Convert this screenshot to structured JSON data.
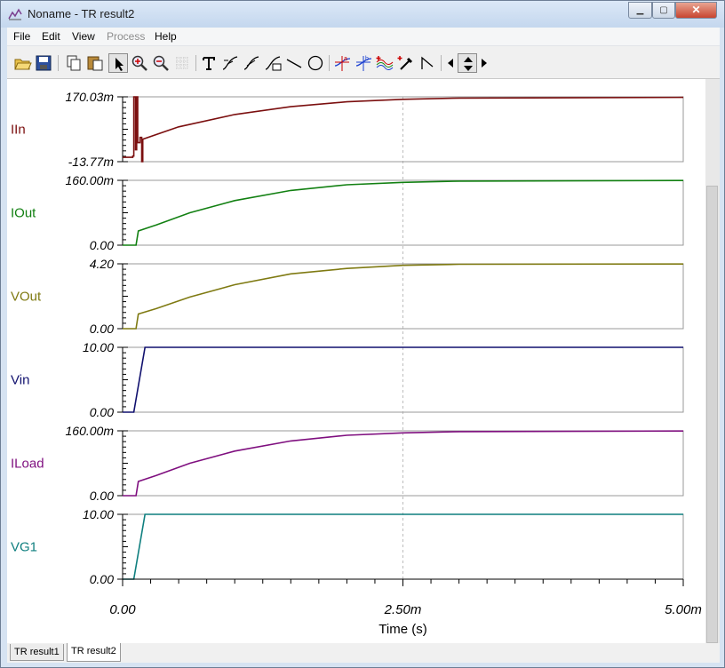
{
  "window": {
    "title": "Noname - TR result2"
  },
  "menu": [
    "File",
    "Edit",
    "View",
    "Process",
    "Help"
  ],
  "menu_disabled": [
    "Process"
  ],
  "toolbar": [
    "open-folder-icon",
    "save-disk-icon",
    "copy-icon",
    "paste-icon",
    "pointer-icon",
    "zoom-in-icon",
    "zoom-out-icon",
    "grid-icon",
    "text-tool-icon",
    "cursor-a-icon",
    "cursor-b-icon",
    "axis-label-icon",
    "line-tool-icon",
    "ellipse-tool-icon",
    "marker-a-icon",
    "marker-b-icon",
    "curves-icon",
    "eyedropper-icon",
    "tangent-icon",
    "arrow-left-icon",
    "arrow-updown-icon",
    "arrow-right-icon"
  ],
  "plot": {
    "x_ticks": [
      "0.00",
      "2.50m",
      "5.00m"
    ],
    "xlabel": "Time (s)",
    "traces": [
      {
        "name": "IIn",
        "ymax": "170.03m",
        "ymin": "-13.77m",
        "color": "#7b0f0f"
      },
      {
        "name": "IOut",
        "ymax": "160.00m",
        "ymin": "0.00",
        "color": "#128012"
      },
      {
        "name": "VOut",
        "ymax": "4.20",
        "ymin": "0.00",
        "color": "#7f7a12"
      },
      {
        "name": "Vin",
        "ymax": "10.00",
        "ymin": "0.00",
        "color": "#10106e"
      },
      {
        "name": "ILoad",
        "ymax": "160.00m",
        "ymin": "0.00",
        "color": "#7f0f7f"
      },
      {
        "name": "VG1",
        "ymax": "10.00",
        "ymin": "0.00",
        "color": "#0f7f7f"
      }
    ]
  },
  "tabs": [
    "TR result1",
    "TR result2"
  ],
  "active_tab": "TR result2",
  "chart_data": {
    "type": "line",
    "x_unit": "s",
    "xlim": [
      0,
      0.005
    ],
    "series": [
      {
        "name": "IIn",
        "ylim": [
          -0.01377,
          0.17003
        ],
        "points": [
          [
            0,
            -0.0014
          ],
          [
            9e-05,
            -0.0014
          ],
          [
            9e-05,
            0.002
          ],
          [
            0.0001,
            0.002
          ],
          [
            0.0001,
            0.17
          ],
          [
            0.000115,
            0.17
          ],
          [
            0.000115,
            0.02
          ],
          [
            0.000125,
            0.02
          ],
          [
            0.000125,
            0.17
          ],
          [
            0.000135,
            0.17
          ],
          [
            0.000135,
            0.04
          ],
          [
            0.000155,
            0.04
          ],
          [
            0.000155,
            0.055
          ],
          [
            0.00017,
            0.055
          ],
          [
            0.00017,
            -0.0138
          ],
          [
            0.00018,
            -0.0138
          ],
          [
            0.00018,
            0.05
          ],
          [
            0.0005,
            0.085
          ],
          [
            0.001,
            0.12
          ],
          [
            0.0015,
            0.142
          ],
          [
            0.002,
            0.156
          ],
          [
            0.0025,
            0.163
          ],
          [
            0.003,
            0.1665
          ],
          [
            0.005,
            0.1685
          ]
        ]
      },
      {
        "name": "IOut",
        "ylim": [
          0,
          0.16
        ],
        "points": [
          [
            0,
            0
          ],
          [
            0.00012,
            0
          ],
          [
            0.00014,
            0.035
          ],
          [
            0.0003,
            0.05
          ],
          [
            0.0006,
            0.08
          ],
          [
            0.001,
            0.11
          ],
          [
            0.0015,
            0.135
          ],
          [
            0.002,
            0.149
          ],
          [
            0.0025,
            0.155
          ],
          [
            0.003,
            0.158
          ],
          [
            0.005,
            0.1595
          ]
        ]
      },
      {
        "name": "VOut",
        "ylim": [
          0,
          4.2
        ],
        "points": [
          [
            0,
            0
          ],
          [
            0.00012,
            0
          ],
          [
            0.00014,
            0.95
          ],
          [
            0.0003,
            1.3
          ],
          [
            0.0006,
            2.05
          ],
          [
            0.001,
            2.85
          ],
          [
            0.0015,
            3.55
          ],
          [
            0.002,
            3.9
          ],
          [
            0.0025,
            4.1
          ],
          [
            0.003,
            4.17
          ],
          [
            0.005,
            4.19
          ]
        ]
      },
      {
        "name": "Vin",
        "ylim": [
          0,
          10
        ],
        "points": [
          [
            0,
            0
          ],
          [
            0.0001,
            0
          ],
          [
            0.0002,
            10
          ],
          [
            0.005,
            10
          ]
        ]
      },
      {
        "name": "ILoad",
        "ylim": [
          0,
          0.16
        ],
        "points": [
          [
            0,
            0
          ],
          [
            0.00012,
            0
          ],
          [
            0.00014,
            0.035
          ],
          [
            0.0003,
            0.05
          ],
          [
            0.0006,
            0.08
          ],
          [
            0.001,
            0.11
          ],
          [
            0.0015,
            0.135
          ],
          [
            0.002,
            0.149
          ],
          [
            0.0025,
            0.155
          ],
          [
            0.003,
            0.158
          ],
          [
            0.005,
            0.1595
          ]
        ]
      },
      {
        "name": "VG1",
        "ylim": [
          0,
          10
        ],
        "points": [
          [
            0,
            0
          ],
          [
            0.0001,
            0
          ],
          [
            0.0002,
            10
          ],
          [
            0.005,
            10
          ]
        ]
      }
    ]
  }
}
